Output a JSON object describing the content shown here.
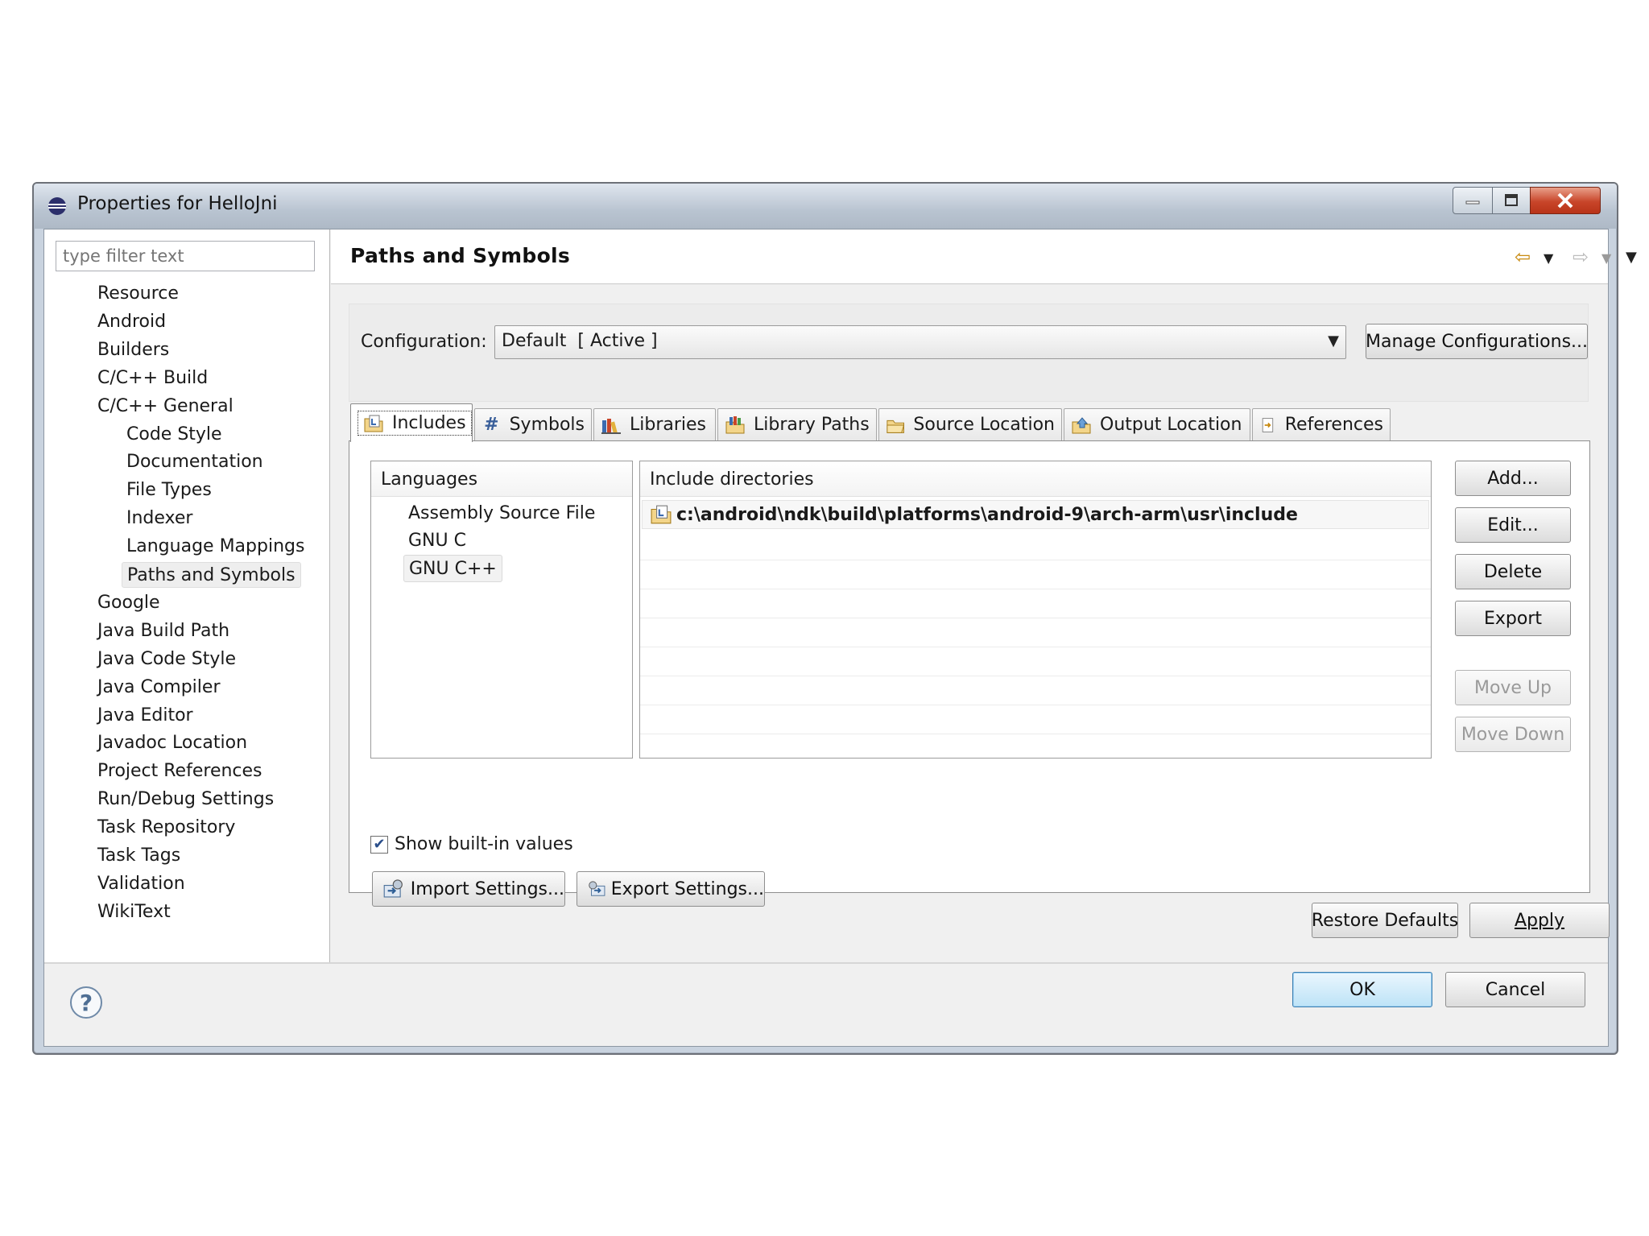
{
  "window": {
    "title": "Properties for HelloJni"
  },
  "filter": {
    "placeholder": "type filter text"
  },
  "tree": {
    "items": [
      {
        "label": "Resource",
        "level": 0
      },
      {
        "label": "Android",
        "level": 0
      },
      {
        "label": "Builders",
        "level": 0
      },
      {
        "label": "C/C++ Build",
        "level": 0
      },
      {
        "label": "C/C++ General",
        "level": 0
      },
      {
        "label": "Code Style",
        "level": 1
      },
      {
        "label": "Documentation",
        "level": 1
      },
      {
        "label": "File Types",
        "level": 1
      },
      {
        "label": "Indexer",
        "level": 1
      },
      {
        "label": "Language Mappings",
        "level": 1
      },
      {
        "label": "Paths and Symbols",
        "level": 1,
        "selected": true
      },
      {
        "label": "Google",
        "level": 0
      },
      {
        "label": "Java Build Path",
        "level": 0
      },
      {
        "label": "Java Code Style",
        "level": 0
      },
      {
        "label": "Java Compiler",
        "level": 0
      },
      {
        "label": "Java Editor",
        "level": 0
      },
      {
        "label": "Javadoc Location",
        "level": 0
      },
      {
        "label": "Project References",
        "level": 0
      },
      {
        "label": "Run/Debug Settings",
        "level": 0
      },
      {
        "label": "Task Repository",
        "level": 0
      },
      {
        "label": "Task Tags",
        "level": 0
      },
      {
        "label": "Validation",
        "level": 0
      },
      {
        "label": "WikiText",
        "level": 0
      }
    ]
  },
  "page": {
    "title": "Paths and Symbols"
  },
  "config": {
    "label": "Configuration:",
    "value": "Default  [ Active ]",
    "manage_label": "Manage Configurations..."
  },
  "tabs": [
    {
      "label": "Includes",
      "icon": "includes-icon",
      "active": true
    },
    {
      "label": "Symbols",
      "icon": "hash-icon"
    },
    {
      "label": "Libraries",
      "icon": "books-icon"
    },
    {
      "label": "Library Paths",
      "icon": "library-paths-icon"
    },
    {
      "label": "Source Location",
      "icon": "folder-icon"
    },
    {
      "label": "Output Location",
      "icon": "output-folder-icon"
    },
    {
      "label": "References",
      "icon": "references-icon"
    }
  ],
  "languages": {
    "header": "Languages",
    "items": [
      "Assembly Source File",
      "GNU C",
      "GNU C++"
    ],
    "selected": "GNU C++"
  },
  "includes": {
    "header": "Include directories",
    "rows": [
      "c:\\android\\ndk\\build\\platforms\\android-9\\arch-arm\\usr\\include"
    ]
  },
  "side_buttons": {
    "add": "Add...",
    "edit": "Edit...",
    "delete": "Delete",
    "export": "Export",
    "move_up": "Move Up",
    "move_down": "Move Down"
  },
  "builtin": {
    "label": "Show built-in values",
    "checked": true
  },
  "settings": {
    "import_label": "Import Settings...",
    "export_label": "Export Settings..."
  },
  "bottom": {
    "restore_label": "Restore Defaults",
    "apply_label": "Apply",
    "ok_label": "OK",
    "cancel_label": "Cancel"
  },
  "colors": {
    "accent": "#3c7fb1",
    "nav_arrow": "#c88a10",
    "close": "#c8452a"
  }
}
